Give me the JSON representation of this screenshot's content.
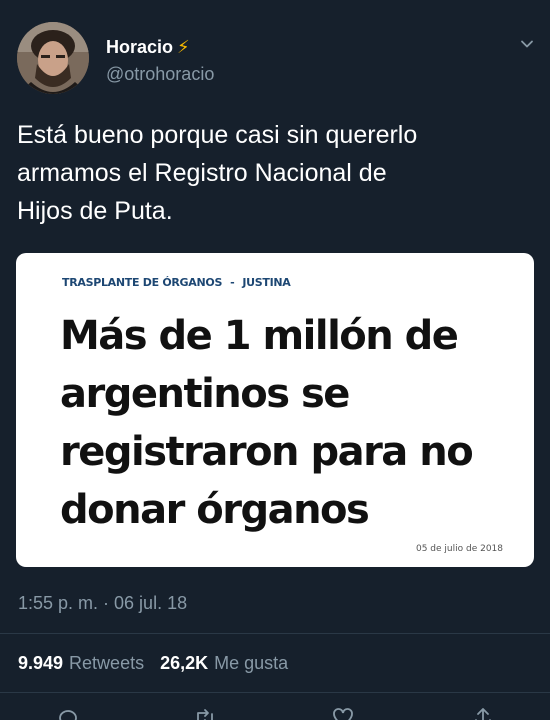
{
  "tweet": {
    "user": {
      "name": "Horacio",
      "badge": "⚡",
      "handle": "@otrohoracio"
    },
    "menu_icon": "chevron-down-icon",
    "text_lines": [
      "Está bueno porque casi sin quererlo",
      "armamos el Registro Nacional de",
      "Hijos de Puta."
    ],
    "card": {
      "kicker_section": "TRASPLANTE DE ÓRGANOS",
      "kicker_separator": "-",
      "kicker_topic": "JUSTINA",
      "headline_lines": [
        "Más de 1 millón de",
        "argentinos se",
        "registraron para no",
        "donar órganos"
      ],
      "date": "05 de julio de 2018"
    },
    "timestamp": "1:55 p. m. · 06 jul. 18",
    "stats": {
      "retweets_count": "9.949",
      "retweets_label": "Retweets",
      "likes_count": "26,2K",
      "likes_label": "Me gusta"
    },
    "actions": [
      "reply-icon",
      "retweet-icon",
      "like-icon",
      "share-icon"
    ]
  },
  "colors": {
    "background": "#16202c",
    "secondary_text": "#8899a6",
    "bolt": "#f5b800",
    "kicker": "#1d4773"
  }
}
